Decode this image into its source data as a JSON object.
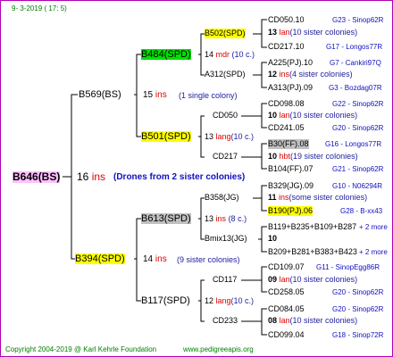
{
  "date_line": "9- 3-2019 ( 17: 5)",
  "root": {
    "id": "B646(BS)",
    "num": "16",
    "unit": "ins",
    "note": "(Drones from 2 sister colonies)"
  },
  "queens": {
    "b569": {
      "id": "B569(BS)",
      "num": "15",
      "unit": "ins",
      "note": "(1 single colony)"
    },
    "b394": {
      "id": "B394(SPD)",
      "num": "14",
      "unit": "ins",
      "note": "(9 sister colonies)"
    },
    "b484": {
      "id": "B484(SPD)",
      "num": "14",
      "unit": "mdr",
      "note": "(10 c.)"
    },
    "b501": {
      "id": "B501(SPD)",
      "num": "13",
      "unit": "lang",
      "note": "(10 c.)"
    },
    "b613": {
      "id": "B613(SPD)",
      "num": "13",
      "unit": "ins",
      "note": "(8 c.)"
    },
    "b117": {
      "id": "B117(SPD)",
      "num": "12",
      "unit": "lang",
      "note": "(10 c.)"
    },
    "b502": {
      "id": "B502(SPD)",
      "num": "13",
      "unit": "lan",
      "note": "(10 sister colonies)"
    },
    "a312": {
      "id": "A312(SPD)",
      "num": "12",
      "unit": "ins",
      "note": "(4 sister colonies)"
    },
    "cd050": {
      "id": "CD050",
      "num": "10",
      "unit": "lan",
      "note": "(10 sister colonies)"
    },
    "cd217": {
      "id": "CD217",
      "num": "10",
      "unit": "hbt",
      "note": "(19 sister colonies)"
    },
    "b358": {
      "id": "B358(JG)",
      "num": "11",
      "unit": "ins",
      "note": "(some sister colonies)"
    },
    "bmix": {
      "id": "Bmix13(JG)",
      "num": "10",
      "unit": "",
      "note": ""
    },
    "cd117": {
      "id": "CD117",
      "num": "09",
      "unit": "lan",
      "note": "(10 sister colonies)"
    },
    "cd233": {
      "id": "CD233",
      "num": "08",
      "unit": "lan",
      "note": "(10 sister colonies)"
    }
  },
  "leaves": {
    "cd050_10": {
      "id": "CD050.10",
      "breeder": "G23 - Sinop62R"
    },
    "cd217_10": {
      "id": "CD217.10",
      "breeder": "G17 - Longos77R"
    },
    "a225": {
      "id": "A225(PJ).10",
      "breeder": "G7 - Cankiri97Q"
    },
    "a313": {
      "id": "A313(PJ).09",
      "breeder": "G3 - Bozdag07R"
    },
    "cd098": {
      "id": "CD098.08",
      "breeder": "G22 - Sinop62R"
    },
    "cd241": {
      "id": "CD241.05",
      "breeder": "G20 - Sinop62R"
    },
    "b30": {
      "id": "B30(FF).08",
      "breeder": "G16 - Longos77R"
    },
    "b104": {
      "id": "B104(FF).07",
      "breeder": "G21 - Sinop62R"
    },
    "b329": {
      "id": "B329(JG).09",
      "breeder": "G10 - N06294R"
    },
    "b190": {
      "id": "B190(PJ).06",
      "breeder": "G28 - B-xx43"
    },
    "b119": {
      "id": "B119+B235+B109+B287",
      "breeder": "+ 2 more"
    },
    "b209": {
      "id": "B209+B281+B383+B423",
      "breeder": "+ 2 more"
    },
    "cd109": {
      "id": "CD109.07",
      "breeder": "G11 - SinopEgg86R"
    },
    "cd258": {
      "id": "CD258.05",
      "breeder": "G20 - Sinop62R"
    },
    "cd084": {
      "id": "CD084.05",
      "breeder": "G20 - Sinop62R"
    },
    "cd099": {
      "id": "CD099.04",
      "breeder": "G18 - Sinop72R"
    }
  },
  "footer": {
    "copyright": "Copyright 2004-2019 @ Karl Kehrle Foundation",
    "url": "www.pedigreeapis.org"
  }
}
